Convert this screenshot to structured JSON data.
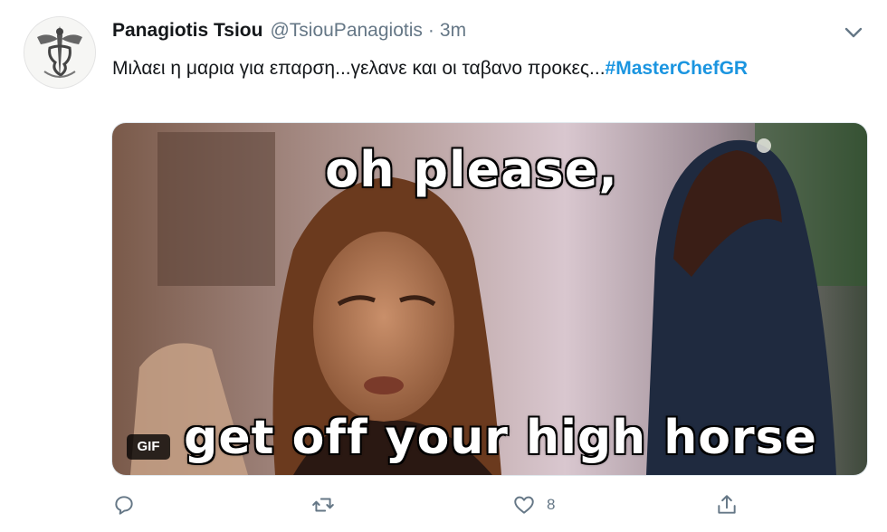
{
  "tweet": {
    "display_name": "Panagiotis Tsiou",
    "handle": "@TsiouPanagiotis",
    "separator": "·",
    "time": "3m",
    "text": "Μιλαει η μαρια για επαρση...γελανε και οι ταβανο προκες...",
    "hashtag": "#MasterChefGR",
    "media": {
      "caption_top": "oh please,",
      "caption_bottom": "get off your high horse",
      "badge": "GIF"
    },
    "actions": {
      "reply_icon": "reply-icon",
      "retweet_icon": "retweet-icon",
      "like_icon": "heart-icon",
      "like_count": "8",
      "share_icon": "share-icon"
    },
    "colors": {
      "hashtag": "#1b95e0",
      "muted": "#657786",
      "text": "#14171a"
    }
  }
}
